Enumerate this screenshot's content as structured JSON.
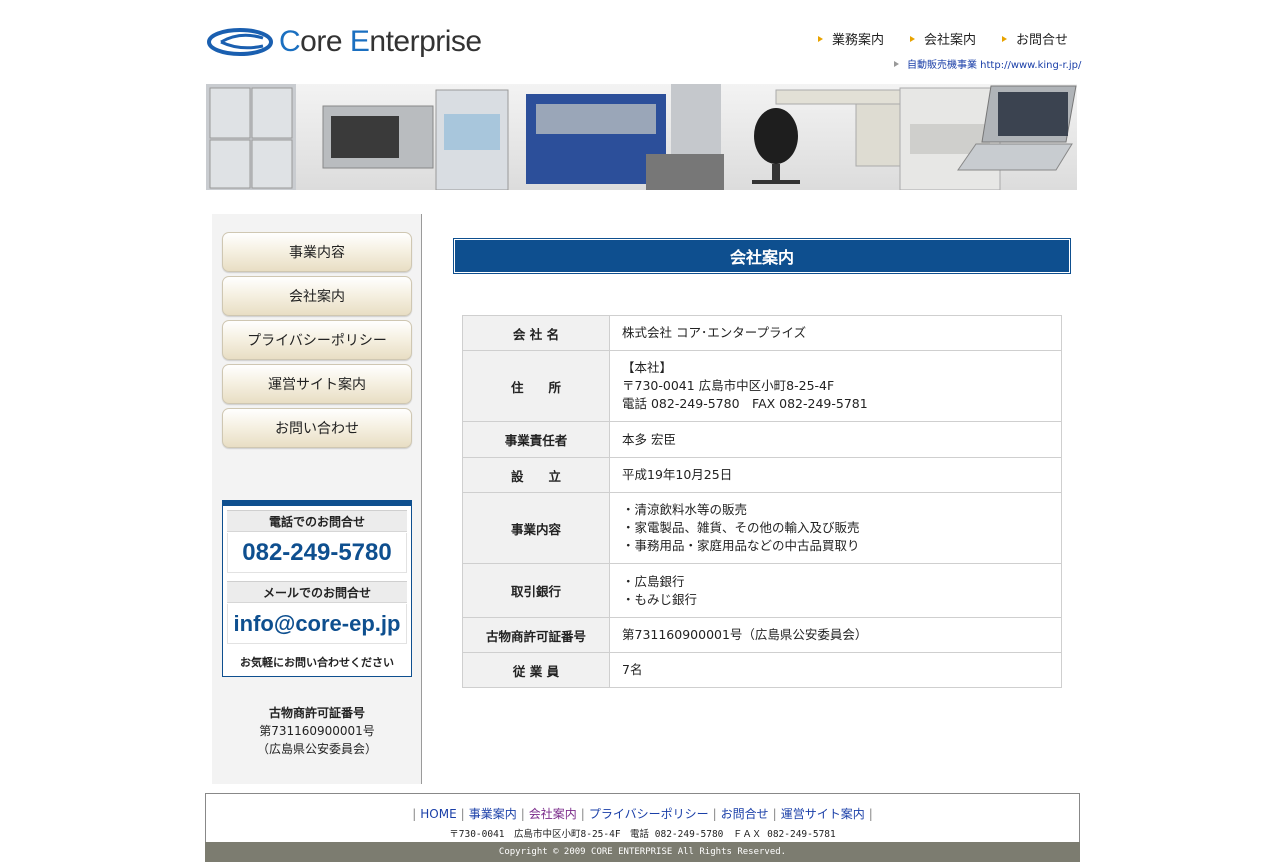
{
  "header": {
    "logo_text_c": "C",
    "logo_text_ore": "ore ",
    "logo_text_e": "E",
    "logo_text_rest": "nterprise",
    "nav": [
      {
        "label": "業務案内"
      },
      {
        "label": "会社案内"
      },
      {
        "label": "お問合せ"
      }
    ],
    "sub_link_label": "自動販売機事業 http://www.king-r.jp/"
  },
  "sidebar": {
    "items": [
      {
        "label": "事業内容"
      },
      {
        "label": "会社案内"
      },
      {
        "label": "プライバシーポリシー"
      },
      {
        "label": "運営サイト案内"
      },
      {
        "label": "お問い合わせ"
      }
    ],
    "phone_heading": "電話でのお問合せ",
    "phone_number": "082-249-5780",
    "mail_heading": "メールでのお問合せ",
    "mail_address": "info@core-ep.jp",
    "contact_note": "お気軽にお問い合わせください",
    "license_title": "古物商許可証番号",
    "license_number": "第731160900001号",
    "license_authority": "（広島県公安委員会）"
  },
  "main": {
    "heading": "会社案内",
    "rows": [
      {
        "key": "会 社 名",
        "lines": [
          "株式会社 コア･エンタープライズ"
        ]
      },
      {
        "key": "住　　所",
        "lines": [
          "【本社】",
          "〒730-0041 広島市中区小町8-25-4F",
          "電話 082-249-5780　FAX 082-249-5781"
        ]
      },
      {
        "key": "事業責任者",
        "lines": [
          "本多 宏臣"
        ]
      },
      {
        "key": "設　　立",
        "lines": [
          "平成19年10月25日"
        ]
      },
      {
        "key": "事業内容",
        "lines": [
          "・清涼飲料水等の販売",
          "・家電製品、雑貨、その他の輸入及び販売",
          "・事務用品・家庭用品などの中古品買取り"
        ]
      },
      {
        "key": "取引銀行",
        "lines": [
          "・広島銀行",
          "・もみじ銀行"
        ]
      },
      {
        "key": "古物商許可証番号",
        "lines": [
          "第731160900001号（広島県公安委員会）"
        ]
      },
      {
        "key": "従 業 員",
        "lines": [
          "7名"
        ]
      }
    ]
  },
  "footer": {
    "links": [
      {
        "label": "HOME"
      },
      {
        "label": "事業案内"
      },
      {
        "label": "会社案内"
      },
      {
        "label": "プライバシーポリシー"
      },
      {
        "label": "お問合せ"
      },
      {
        "label": "運営サイト案内"
      }
    ],
    "separator": "|",
    "address": "〒730-0041　広島市中区小町8-25-4F　電話 082-249-5780　ＦＡＸ 082-249-5781",
    "copyright": "Copyright ©  2009 CORE ENTERPRISE All Rights Reserved."
  },
  "colors": {
    "brand_blue": "#0e4f8f",
    "nav_arrow": "#e8a300",
    "link": "#1a3fa8",
    "footer_bar": "#7c7c70"
  }
}
